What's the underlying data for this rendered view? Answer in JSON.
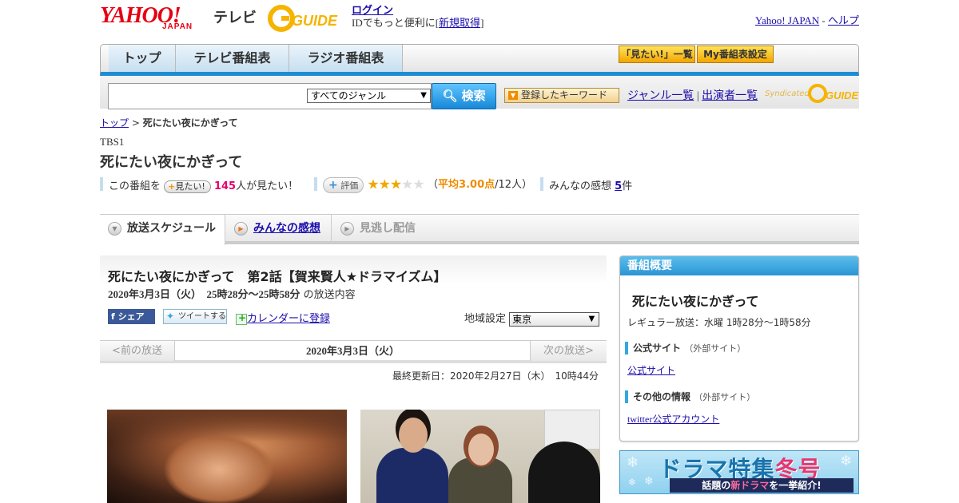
{
  "header": {
    "yahoo_logo": "YAHOO!",
    "japan_logo": "JAPAN",
    "tv_label": "テレビ",
    "gguide_logo": "GUIDE",
    "login": "ログイン",
    "login_desc": "IDでもっと便利に[",
    "register": "新規取得",
    "login_desc_end": "]",
    "yahoo_japan_link": "Yahoo! JAPAN",
    "sep": " - ",
    "help_link": "ヘルプ"
  },
  "nav": {
    "tabs": [
      {
        "label": "トップ"
      },
      {
        "label": "テレビ番組表"
      },
      {
        "label": "ラジオ番組表"
      }
    ],
    "mitai_list": "「見たい!」一覧",
    "my_schedule": "My番組表設定"
  },
  "search": {
    "query": "",
    "genre_selected": "すべてのジャンル",
    "button_label": "検索",
    "keyword_button": "登録したキーワード",
    "genre_list_link": "ジャンル一覧",
    "divider": "|",
    "performer_link": "出演者一覧",
    "syndicated": "Syndicated",
    "syndicated_logo": "GUIDE"
  },
  "breadcrumb": {
    "top": "トップ",
    "sep": ">",
    "current": "死にたい夜にかぎって"
  },
  "program": {
    "channel": "TBS1",
    "title": "死にたい夜にかぎって",
    "mitai_prefix": "この番組を",
    "mitai_button": "見たい!",
    "mitai_count": "145",
    "mitai_suffix": "人が見たい！",
    "rating_button": "評価",
    "rating_value": 3,
    "rating_max": 5,
    "rating_open": "（",
    "rating_avg": "平均3.00点",
    "rating_count": "/12人）",
    "kanso_label": "みんなの感想",
    "kanso_count": "5",
    "kanso_suffix": "件"
  },
  "tabs": {
    "schedule": "放送スケジュール",
    "kanso": "みんなの感想",
    "minogashi": "見逃し配信"
  },
  "episode": {
    "title": "死にたい夜にかぎって　第2話【賀来賢人★ドラマイズム】",
    "date": "2020年3月3日（火）　25時28分～25時58分",
    "date_suffix": "の放送内容",
    "share_fb": "シェア",
    "share_tw": "ツイートする",
    "calendar": "カレンダーに登録",
    "region_label": "地域設定",
    "region_value": "東京",
    "prev": "<前の放送",
    "current_date": "2020年3月3日（火）",
    "next": "次の放送>",
    "updated": "最終更新日：2020年2月27日（木）　10時44分"
  },
  "sidebar": {
    "header": "番組概要",
    "title": "死にたい夜にかぎって",
    "regular": "レギュラー放送：水曜 1時28分～1時58分",
    "official_label": "公式サイト",
    "official_ext": "（外部サイト）",
    "official_link": "公式サイト",
    "other_label": "その他の情報",
    "other_ext": "（外部サイト）",
    "twitter_link": "twitter公式アカウント"
  },
  "banner": {
    "title_main": "ドラマ特集",
    "title_accent": "冬号",
    "sub_pre": "話題の",
    "sub_hl": "新ドラマ",
    "sub_post": "を一挙紹介!"
  },
  "colors": {
    "yahoo_red": "#e60012",
    "nav_blue": "#1d8ed4",
    "count_pink": "#e5006e",
    "star_gold": "#f0a800"
  }
}
